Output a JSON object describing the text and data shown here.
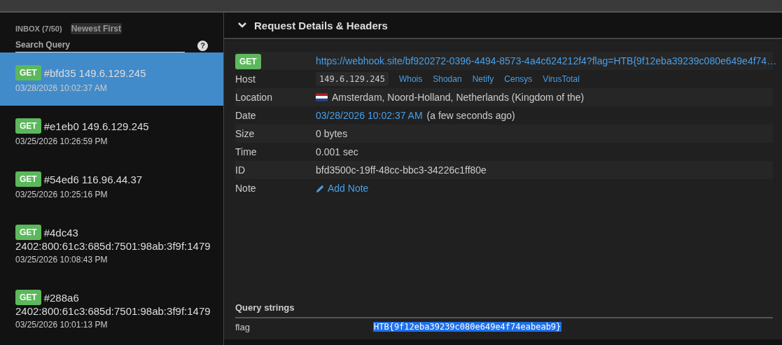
{
  "inbox": {
    "title": "INBOX (7/50)",
    "sort": "Newest First",
    "search": {
      "placeholder": "Search Query"
    },
    "help": "?"
  },
  "requests": [
    {
      "method": "GET",
      "id": "#bfd35",
      "ip": "149.6.129.245",
      "date": "03/28/2026 10:02:37 AM",
      "selected": true
    },
    {
      "method": "GET",
      "id": "#e1eb0",
      "ip": "149.6.129.245",
      "date": "03/25/2026 10:26:59 PM",
      "selected": false
    },
    {
      "method": "GET",
      "id": "#54ed6",
      "ip": "116.96.44.37",
      "date": "03/25/2026 10:25:16 PM",
      "selected": false
    },
    {
      "method": "GET",
      "id": "#4dc43",
      "ip": "2402:800:61c3:685d:7501:98ab:3f9f:1479",
      "date": "03/25/2026 10:08:43 PM",
      "selected": false
    },
    {
      "method": "GET",
      "id": "#288a6",
      "ip": "2402:800:61c3:685d:7501:98ab:3f9f:1479",
      "date": "03/25/2026 10:01:13 PM",
      "selected": false
    }
  ],
  "details": {
    "title": "Request Details & Headers",
    "expanded": true,
    "method": "GET",
    "url": "https://webhook.site/bf920272-0396-4494-8573-4a4c624212f4?flag=HTB{9f12eba39239c080e649e4f74…",
    "rows": [
      {
        "kind": "host",
        "label": "Host",
        "value": "149.6.129.245",
        "links": [
          "Whois",
          "Shodan",
          "Netify",
          "Censys",
          "VirusTotal"
        ]
      },
      {
        "kind": "location",
        "label": "Location",
        "value": "Amsterdam, Noord-Holland, Netherlands (Kingdom of the)"
      },
      {
        "kind": "date",
        "label": "Date",
        "value": "03/28/2026 10:02:37 AM",
        "note": "(a few seconds ago)"
      },
      {
        "kind": "text",
        "label": "Size",
        "value": "0 bytes"
      },
      {
        "kind": "text",
        "label": "Time",
        "value": "0.001 sec"
      },
      {
        "kind": "text",
        "label": "ID",
        "value": "bfd3500c-19ff-48cc-bbc3-34226c1ff80e"
      },
      {
        "kind": "note",
        "label": "Note",
        "value": "Add Note"
      }
    ]
  },
  "query_strings": {
    "title": "Query strings",
    "rows": [
      {
        "name": "flag",
        "value": "HTB{9f12eba39239c080e649e4f74eabeab9}",
        "selected": true
      }
    ]
  }
}
